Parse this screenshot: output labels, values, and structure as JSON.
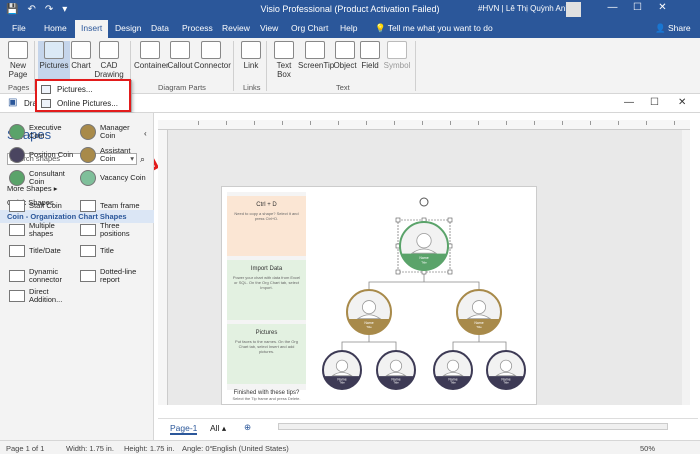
{
  "window": {
    "title": "Visio Professional (Product Activation Failed)",
    "user": "#HVN | Lê Thị Quỳnh Anh",
    "controls": [
      "—",
      "☐",
      "✕"
    ]
  },
  "quick_access": [
    "💾",
    "↶",
    "↷",
    "▾"
  ],
  "tabs": [
    "File",
    "Home",
    "Insert",
    "Design",
    "Data",
    "Process",
    "Review",
    "View",
    "Org Chart",
    "Help"
  ],
  "active_tab": "Insert",
  "tell_me": "Tell me what you want to do",
  "share": "Share",
  "ribbon": {
    "new_page": "New\nPage",
    "pictures": "Pictures",
    "chart": "Chart",
    "cad": "CAD\nDrawing",
    "container": "Container",
    "callout": "Callout",
    "connector": "Connector",
    "link": "Link",
    "text_box": "Text\nBox",
    "screentip": "ScreenTip",
    "object": "Object",
    "field": "Field",
    "symbol": "Symbol",
    "groups": {
      "pages": "Pages",
      "diagram_parts": "Diagram Parts",
      "links": "Links",
      "text": "Text"
    }
  },
  "pictures_menu": {
    "items": [
      "Pictures...",
      "Online Pictures..."
    ]
  },
  "doc_tab": "Drav",
  "shapes_panel": {
    "title": "Shapes",
    "search_placeholder": "Search shapes",
    "more_shapes": "More Shapes",
    "quick_shapes": "Quick Shapes",
    "stencil": "Coin - Organization Chart Shapes",
    "items": [
      {
        "label": "Executive\nCoin",
        "color": "#5aa36a"
      },
      {
        "label": "Manager\nCoin",
        "color": "#a88a4a"
      },
      {
        "label": "Position Coin",
        "color": "#4a4560"
      },
      {
        "label": "Assistant\nCoin",
        "color": "#a88a4a"
      },
      {
        "label": "Consultant\nCoin",
        "color": "#5aa36a"
      },
      {
        "label": "Vacancy Coin",
        "color": "#7fbf9a"
      },
      {
        "label": "Staff Coin",
        "color": ""
      },
      {
        "label": "Team frame",
        "color": ""
      },
      {
        "label": "Multiple\nshapes",
        "color": ""
      },
      {
        "label": "Three\npositions",
        "color": ""
      },
      {
        "label": "Title/Date",
        "color": ""
      },
      {
        "label": "Title",
        "color": ""
      },
      {
        "label": "Dynamic\nconnector",
        "color": ""
      },
      {
        "label": "Dotted-line\nreport",
        "color": ""
      },
      {
        "label": "Direct\nAddition...",
        "color": ""
      }
    ]
  },
  "tips": [
    {
      "title": "Ctrl + D",
      "body": "Need to copy a shape? Select it and press Ctrl+D.",
      "bg": "#fbe6d4"
    },
    {
      "title": "Import Data",
      "body": "Power your chart with data from Excel or SQL. On the Org Chart tab, select Import.",
      "bg": "#e3f1e1"
    },
    {
      "title": "Pictures",
      "body": "Put faces to the names. On the Org Chart tab, select Insert and add pictures.",
      "bg": "#e3f1e1"
    },
    {
      "title": "Finished with these tips?",
      "body": "Select the Tip frame and press Delete.",
      "bg": "#ffffff"
    }
  ],
  "org_chart": {
    "top": {
      "name": "Name",
      "title": "Title",
      "color": "#5aa36a"
    },
    "managers": [
      {
        "name": "Name",
        "title": "Title",
        "color": "#a88a4a"
      },
      {
        "name": "Name",
        "title": "Title",
        "color": "#a88a4a"
      }
    ],
    "staff": [
      {
        "name": "Name",
        "title": "Title",
        "color": "#3d3a55"
      },
      {
        "name": "Name",
        "title": "Title",
        "color": "#3d3a55"
      },
      {
        "name": "Name",
        "title": "Title",
        "color": "#3d3a55"
      },
      {
        "name": "Name",
        "title": "Title",
        "color": "#3d3a55"
      }
    ]
  },
  "page_tabs": {
    "page": "Page-1",
    "all": "All",
    "add": "⊕"
  },
  "status": {
    "page": "Page 1 of 1",
    "width": "Width: 1.75 in.",
    "height": "Height: 1.75 in.",
    "angle": "Angle: 0°",
    "language": "English (United States)",
    "zoom": "50%"
  },
  "accent": "#2b579a",
  "highlight": "#e21b1b"
}
